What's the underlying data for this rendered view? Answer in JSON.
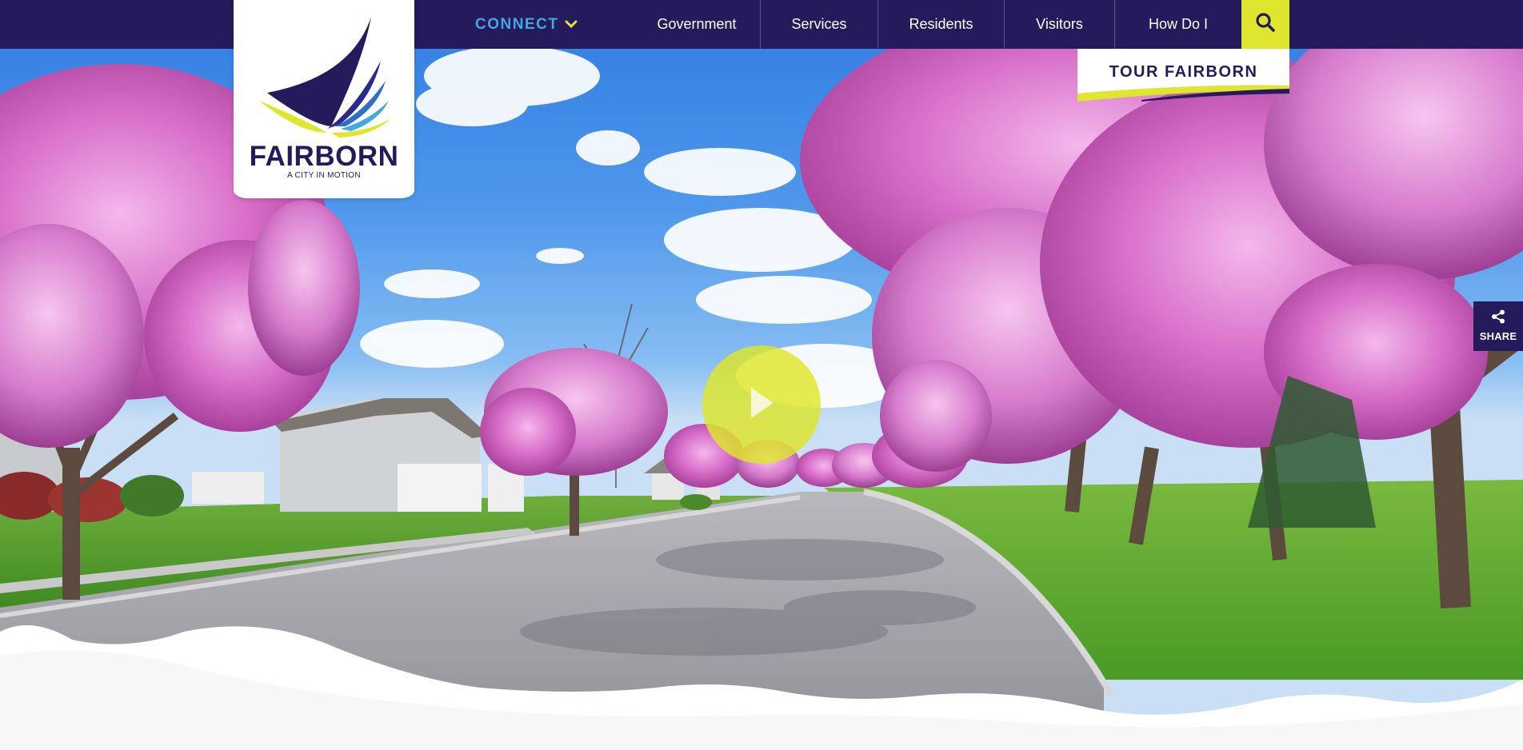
{
  "brand": {
    "name": "FAIRBORN",
    "tagline": "A CITY IN MOTION",
    "logo_icon": "wing-swoosh-logo",
    "colors": {
      "navy": "#241a5c",
      "yellow": "#dfe62e",
      "blue": "#3fa9e0",
      "white": "#ffffff"
    }
  },
  "nav": {
    "connect_label": "CONNECT",
    "connect_icon": "chevron-down-icon",
    "items": [
      {
        "label": "Government"
      },
      {
        "label": "Services"
      },
      {
        "label": "Residents"
      },
      {
        "label": "Visitors"
      },
      {
        "label": "How Do I"
      }
    ],
    "search_icon": "search-icon"
  },
  "tour": {
    "label": "TOUR FAIRBORN"
  },
  "hero": {
    "play_icon": "play-icon"
  },
  "share": {
    "label": "SHARE",
    "icon": "share-icon"
  }
}
